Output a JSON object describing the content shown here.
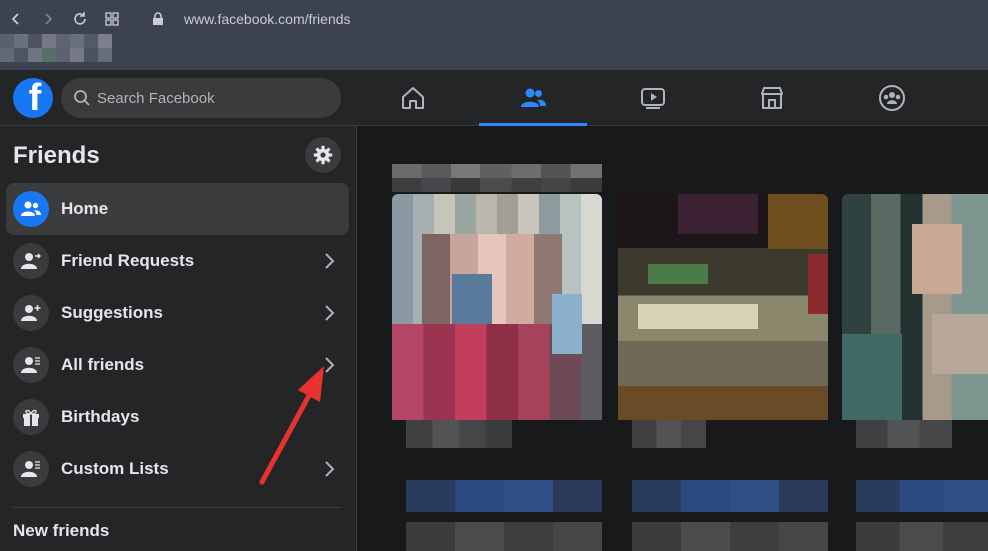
{
  "browser": {
    "url": "www.facebook.com/friends"
  },
  "header": {
    "search_placeholder": "Search Facebook",
    "tabs": [
      {
        "icon": "home-icon",
        "active": false
      },
      {
        "icon": "friends-icon",
        "active": true
      },
      {
        "icon": "watch-icon",
        "active": false
      },
      {
        "icon": "marketplace-icon",
        "active": false
      },
      {
        "icon": "groups-icon",
        "active": false
      }
    ]
  },
  "sidebar": {
    "title": "Friends",
    "items": [
      {
        "label": "Home",
        "icon": "friends-home-icon",
        "active": true,
        "chevron": false
      },
      {
        "label": "Friend Requests",
        "icon": "friend-requests-icon",
        "active": false,
        "chevron": true
      },
      {
        "label": "Suggestions",
        "icon": "suggestions-icon",
        "active": false,
        "chevron": true
      },
      {
        "label": "All friends",
        "icon": "all-friends-icon",
        "active": false,
        "chevron": true
      },
      {
        "label": "Birthdays",
        "icon": "gift-icon",
        "active": false,
        "chevron": false
      },
      {
        "label": "Custom Lists",
        "icon": "custom-lists-icon",
        "active": false,
        "chevron": true
      }
    ],
    "section_heading": "New friends"
  },
  "colors": {
    "accent": "#2d88ff",
    "fb_blue": "#1877f2",
    "annotation_arrow": "#e8322e"
  }
}
